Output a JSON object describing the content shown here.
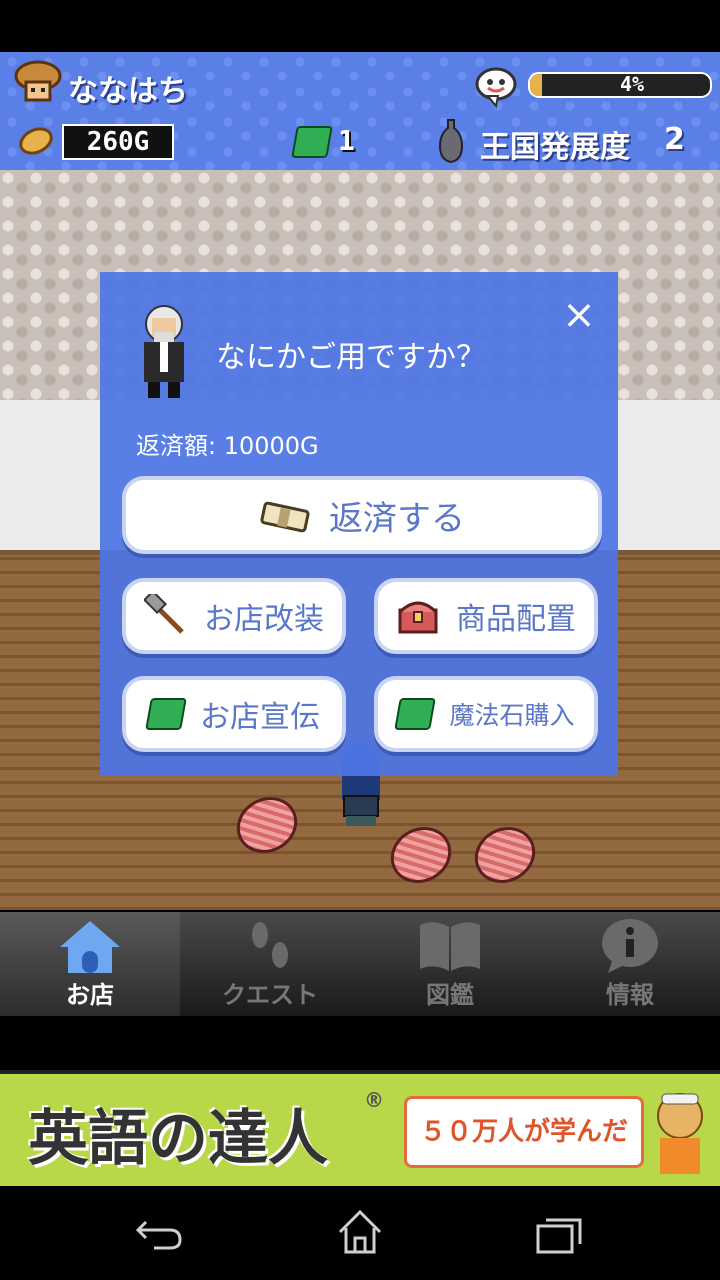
{
  "hud": {
    "player_name": "ななはち",
    "gold": "260G",
    "magic_stones": "1",
    "kingdom_label": "王国発展度",
    "kingdom_level": "2",
    "progress_text": "4%",
    "progress_value": 0.04
  },
  "dialog": {
    "message": "なにかご用ですか？",
    "close_symbol": "×",
    "repay_amount": "返済額: 10000G",
    "buttons": {
      "repay": "返済する",
      "renovate": "お店改装",
      "place_items": "商品配置",
      "advertise": "お店宣伝",
      "buy_stones": "魔法石購入"
    }
  },
  "tabs": [
    {
      "label": "お店",
      "icon": "house-icon",
      "active": true
    },
    {
      "label": "クエスト",
      "icon": "footprints-icon",
      "active": false
    },
    {
      "label": "図鑑",
      "icon": "book-icon",
      "active": false
    },
    {
      "label": "情報",
      "icon": "info-icon",
      "active": false
    }
  ],
  "ad": {
    "title": "英語の達人",
    "registered": "®",
    "subtitle": "５０万人が学んだ"
  },
  "colors": {
    "dialog_bg": "#4d75e5",
    "button_text": "#5a77c9",
    "ad_bg": "#b8d84a"
  }
}
